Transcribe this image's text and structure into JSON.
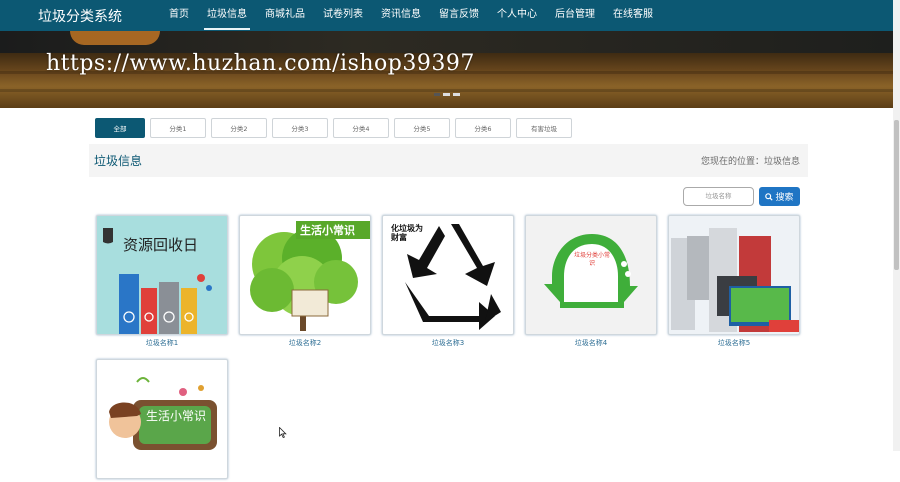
{
  "navbar": {
    "brand": "垃圾分类系统",
    "items": [
      {
        "label": "首页",
        "active": false
      },
      {
        "label": "垃圾信息",
        "active": true
      },
      {
        "label": "商城礼品",
        "active": false
      },
      {
        "label": "试卷列表",
        "active": false
      },
      {
        "label": "资讯信息",
        "active": false
      },
      {
        "label": "留言反馈",
        "active": false
      },
      {
        "label": "个人中心",
        "active": false
      },
      {
        "label": "后台管理",
        "active": false
      },
      {
        "label": "在线客服",
        "active": false
      }
    ]
  },
  "banner": {
    "watermark": "https://www.huzhan.com/ishop39397",
    "slide_count": 3,
    "active_slide": 1
  },
  "filter_tabs": [
    "全部",
    "分类1",
    "分类2",
    "分类3",
    "分类4",
    "分类5",
    "分类6",
    "有害垃圾"
  ],
  "section": {
    "title": "垃圾信息",
    "breadcrumb": "您现在的位置：垃圾信息"
  },
  "search": {
    "placeholder": "垃圾名称",
    "button_label": "搜索",
    "button_icon": "search-icon"
  },
  "items": [
    {
      "name": "垃圾名称1",
      "image_text": "资源回收日"
    },
    {
      "name": "垃圾名称2",
      "image_text": "生活小常识"
    },
    {
      "name": "垃圾名称3",
      "image_text": "化垃圾为财富"
    },
    {
      "name": "垃圾名称4",
      "image_text": "垃圾分类小常识"
    },
    {
      "name": "垃圾名称5",
      "image_text": ""
    },
    {
      "name": "",
      "image_text": "生活小常识"
    }
  ],
  "colors": {
    "navbar": "#0c5873",
    "accent": "#1f75c4",
    "card_label": "#2f6f95"
  }
}
